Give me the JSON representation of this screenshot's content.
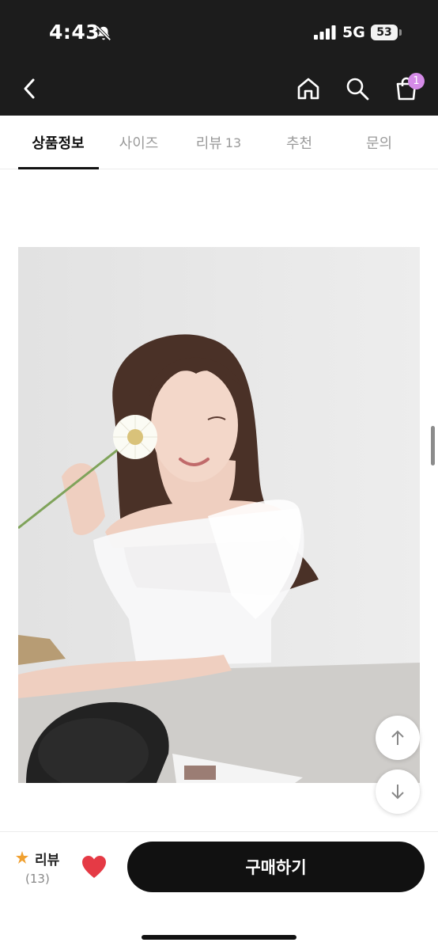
{
  "status_bar": {
    "time": "4:43",
    "network": "5G",
    "battery": "53",
    "icons": [
      "bell-slash-icon",
      "signal-icon",
      "battery-icon"
    ]
  },
  "nav": {
    "icons": [
      "back-icon",
      "home-icon",
      "search-icon",
      "cart-icon"
    ],
    "cart_badge": "1",
    "badge_color": "#d58be8"
  },
  "tabs": [
    {
      "label": "상품정보",
      "active": true
    },
    {
      "label": "사이즈",
      "active": false
    },
    {
      "label": "리뷰",
      "count": "13",
      "active": false
    },
    {
      "label": "추천",
      "active": false
    },
    {
      "label": "문의",
      "active": false
    }
  ],
  "product_image": {
    "kind": "photo",
    "subject": "model in white off-shoulder top holding a daisy"
  },
  "float_buttons": [
    "arrow-up-icon",
    "arrow-down-icon"
  ],
  "bottom_bar": {
    "review_label": "리뷰",
    "review_count": "(13)",
    "buy_label": "구매하기",
    "star_color": "#f0a030",
    "heart_color": "#e53a45"
  }
}
